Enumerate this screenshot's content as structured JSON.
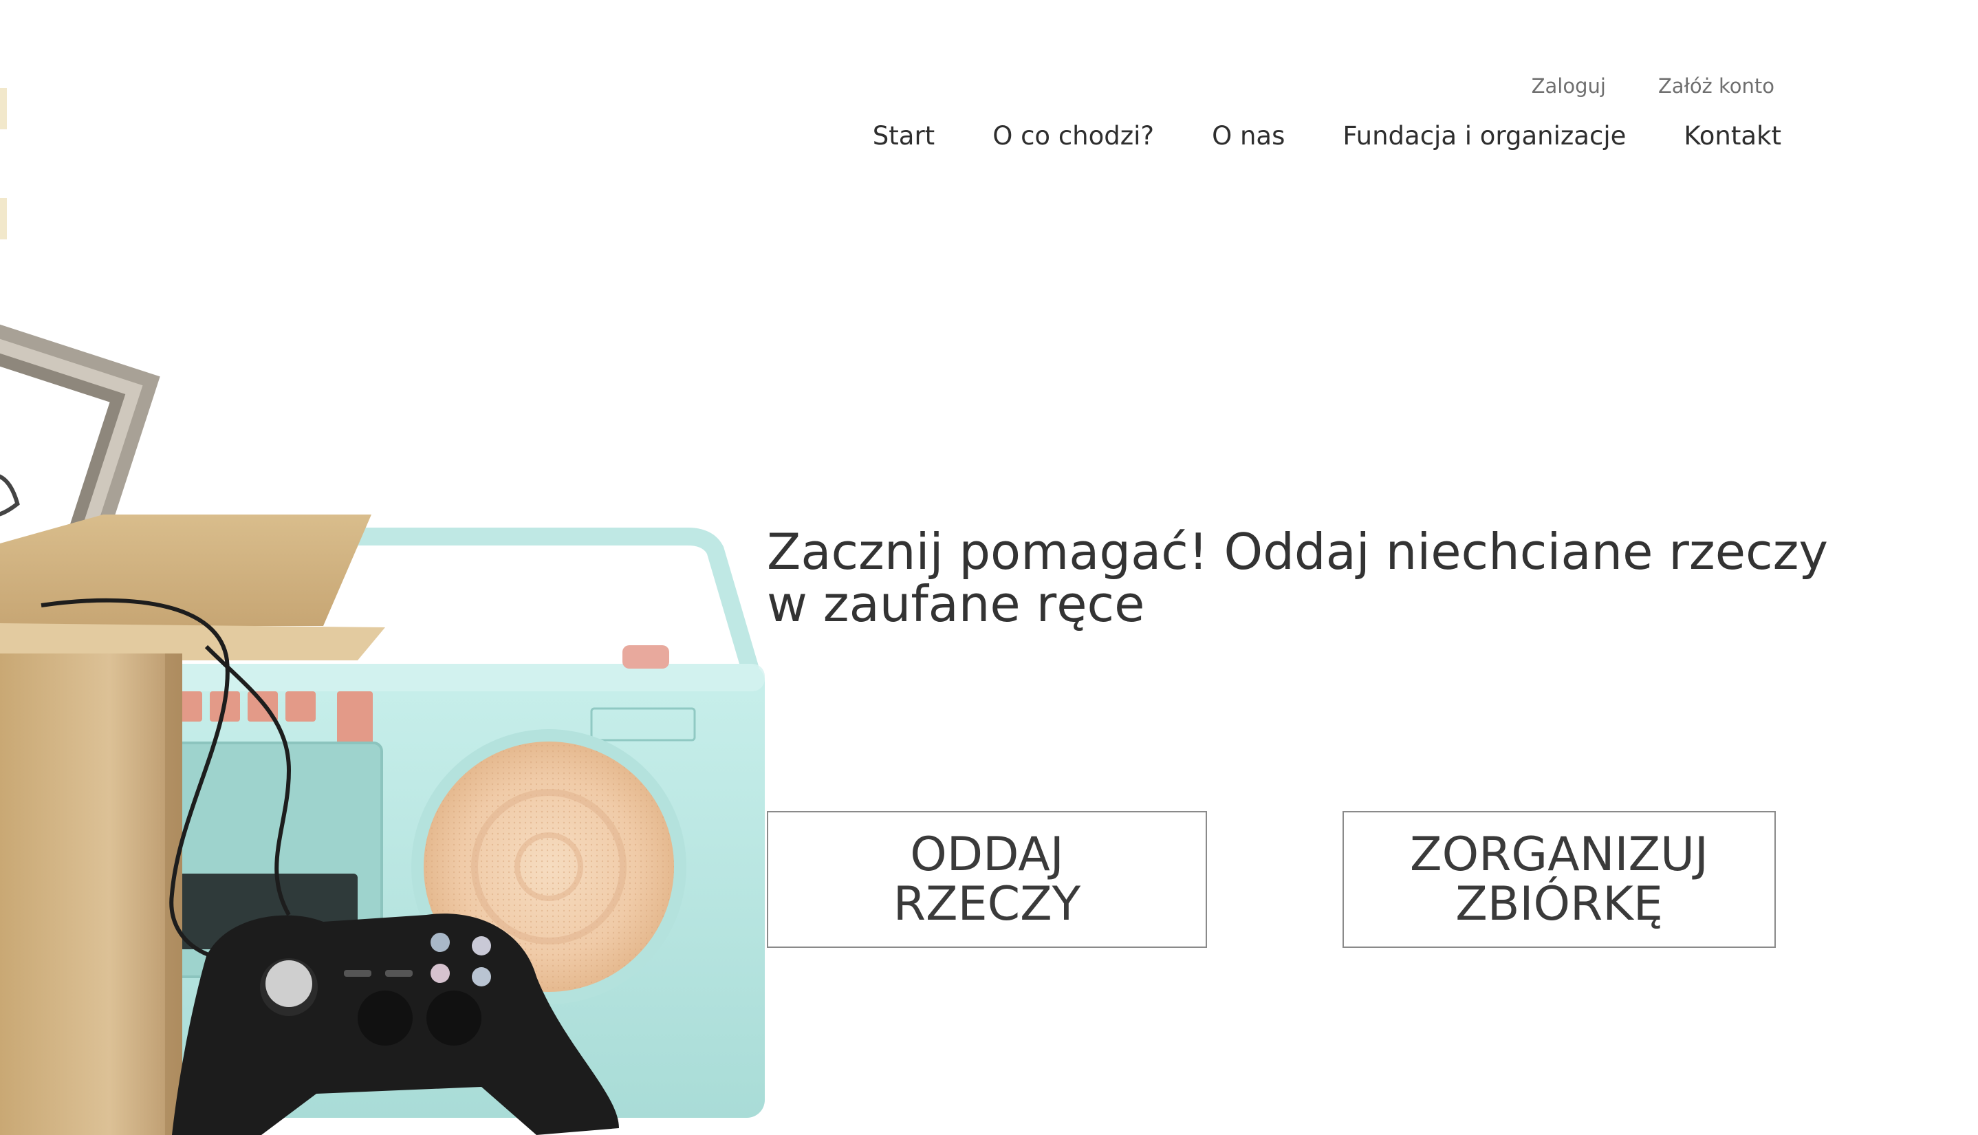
{
  "header": {
    "auth": {
      "login": "Zaloguj",
      "register": "Załóż konto"
    },
    "nav": [
      {
        "label": "Start"
      },
      {
        "label": "O co chodzi?"
      },
      {
        "label": "O nas"
      },
      {
        "label": "Fundacja i organizacje"
      },
      {
        "label": "Kontakt"
      }
    ]
  },
  "hero": {
    "title": "Zacznij pomagać! Oddaj niechciane rzeczy w zaufane ręce",
    "image": "donation-box-with-radio-and-gamepad",
    "buttons": {
      "give": "Oddaj rzeczy",
      "organize": "Zorganizuj zbiórkę"
    }
  },
  "colors": {
    "background": "#ffffff",
    "text": "#333333",
    "nav_text": "#2e2e2e",
    "auth_text": "#6f6f6f",
    "button_border": "#8a8a8a",
    "radio": "#bfe8e4",
    "speaker": "#f0cba8",
    "box": "#d8b98a"
  }
}
